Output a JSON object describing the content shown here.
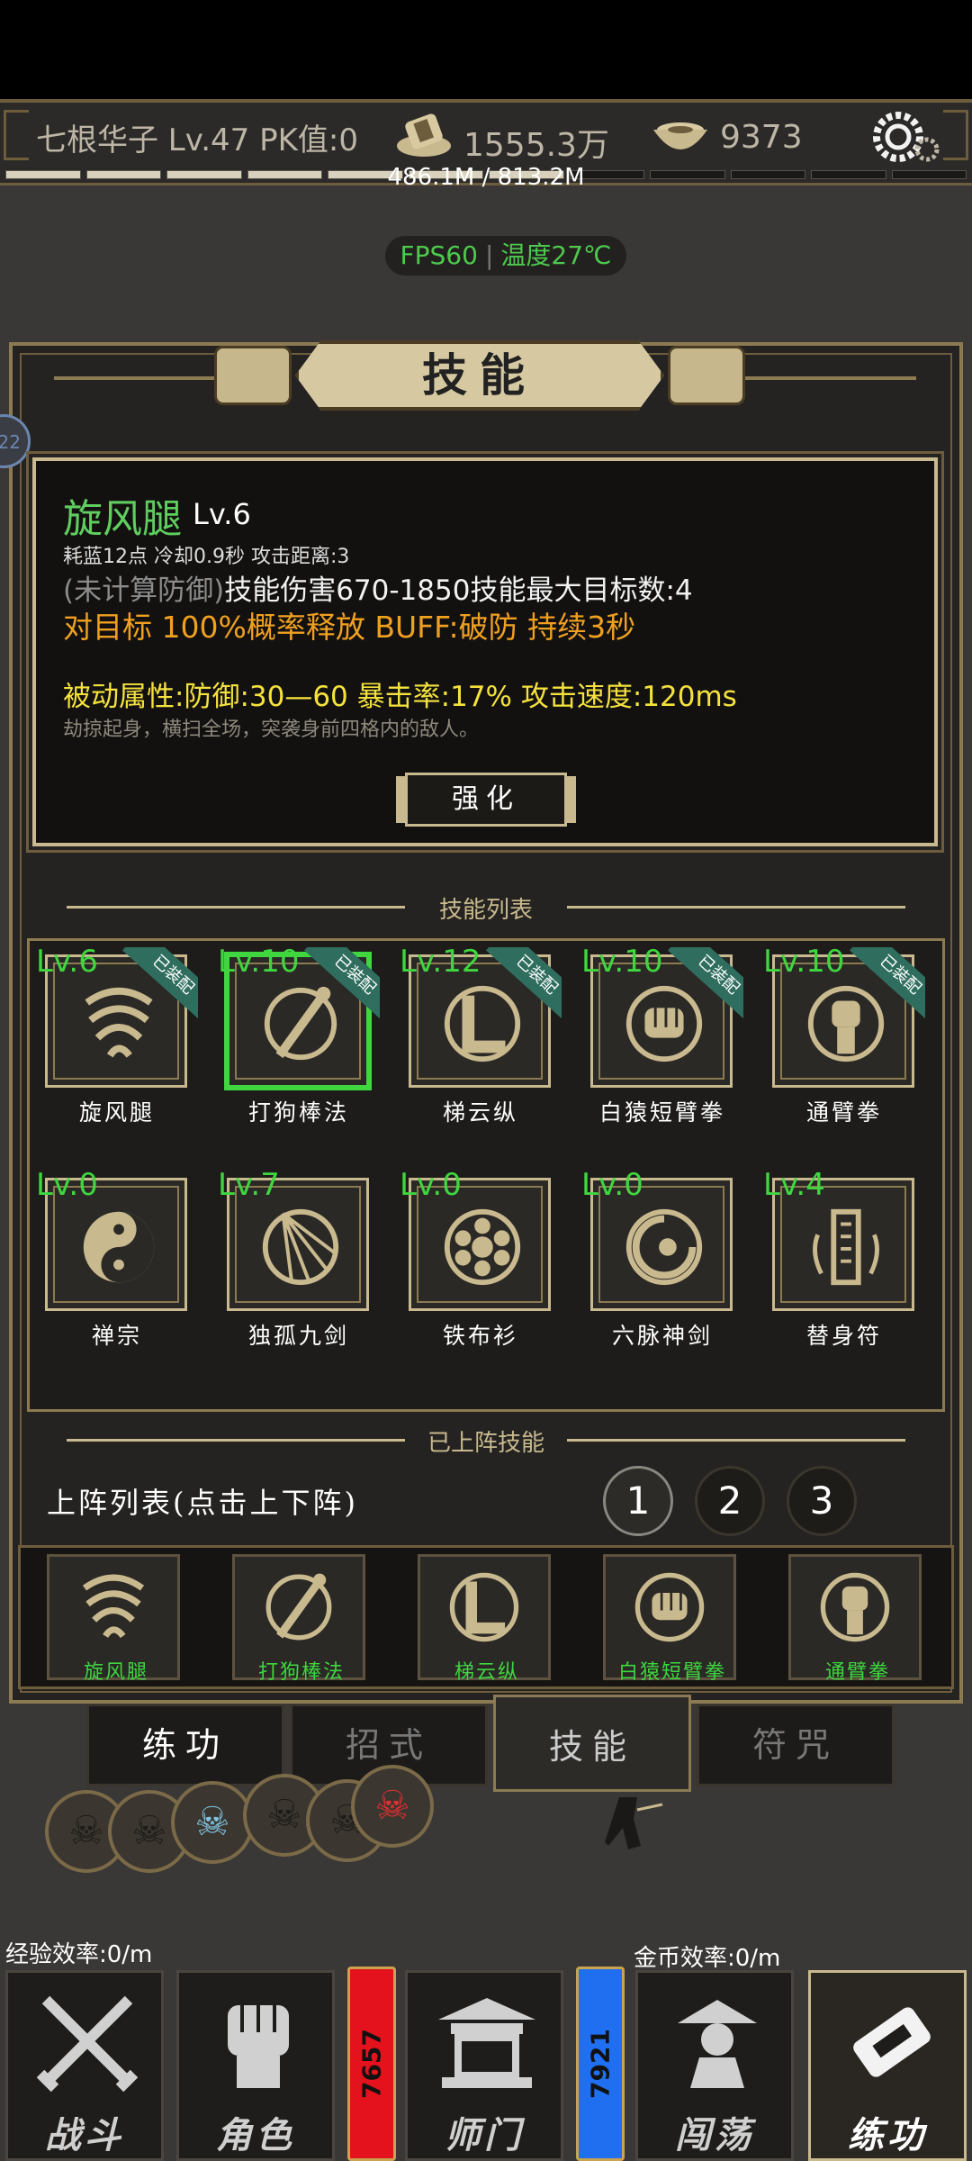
{
  "header": {
    "player": "七根华子  Lv.47  PK值:0",
    "coins": "1555.3万",
    "ingots": "9373",
    "exp_text": "486.1M / 813.2M"
  },
  "fps": {
    "fps": "FPS60",
    "temp": "温度27℃"
  },
  "side_badge": "22",
  "panel": {
    "title": "技能",
    "selected": {
      "name": "旋风腿",
      "level": "Lv.6",
      "meta": "耗蓝12点 冷却0.9秒 攻击距离:3",
      "dmg_prefix": "(未计算防御)",
      "dmg": "技能伤害670-1850技能最大目标数:4",
      "buff": "对目标 100%概率释放 BUFF:破防 持续3秒",
      "passive": "被动属性:防御:30—60    暴击率:17% 攻击速度:120ms",
      "desc": "劫掠起身，横扫全场，突袭身前四格内的敌人。",
      "enhance": "强化"
    },
    "list_title": "技能列表",
    "equipped_tag": "已装配",
    "skills": [
      {
        "name": "旋风腿",
        "level": "Lv.6",
        "equipped": true,
        "icon": "whirlwind-icon"
      },
      {
        "name": "打狗棒法",
        "level": "Lv.10",
        "equipped": true,
        "icon": "staff-icon"
      },
      {
        "name": "梯云纵",
        "level": "Lv.12",
        "equipped": true,
        "icon": "ladder-step-icon"
      },
      {
        "name": "白猿短臂拳",
        "level": "Lv.10",
        "equipped": true,
        "icon": "fist-icon"
      },
      {
        "name": "通臂拳",
        "level": "Lv.10",
        "equipped": true,
        "icon": "raised-fist-icon"
      },
      {
        "name": "禅宗",
        "level": "Lv.0",
        "equipped": false,
        "icon": "yin-yang-icon"
      },
      {
        "name": "独孤九剑",
        "level": "Lv.7",
        "equipped": false,
        "icon": "sword-rays-icon"
      },
      {
        "name": "铁布衫",
        "level": "Lv.0",
        "equipped": false,
        "icon": "turtle-shell-icon"
      },
      {
        "name": "六脉神剑",
        "level": "Lv.0",
        "equipped": false,
        "icon": "vortex-icon"
      },
      {
        "name": "替身符",
        "level": "Lv.4",
        "equipped": false,
        "icon": "talisman-icon"
      }
    ],
    "deployed_title": "已上阵技能",
    "lineup_label": "上阵列表(点击上下阵)",
    "pages": [
      "1",
      "2",
      "3"
    ],
    "lineup": [
      "旋风腿",
      "打狗棒法",
      "梯云纵",
      "白猿短臂拳",
      "通臂拳"
    ]
  },
  "tabs": [
    "练功",
    "招式",
    "技能",
    "符咒"
  ],
  "efficiency": {
    "exp": "经验效率:0/m",
    "gold": "金币效率:0/m"
  },
  "nav": {
    "items": [
      "战斗",
      "角色",
      "师门",
      "闯荡",
      "练功"
    ],
    "hp": "7657",
    "mp": "7921"
  },
  "colors": {
    "accent": "#c9b98e",
    "level_green": "#3fd63f",
    "buff_orange": "#f0a020",
    "passive_yellow": "#f5e23c",
    "equipped_tag": "#2f6e5e"
  }
}
